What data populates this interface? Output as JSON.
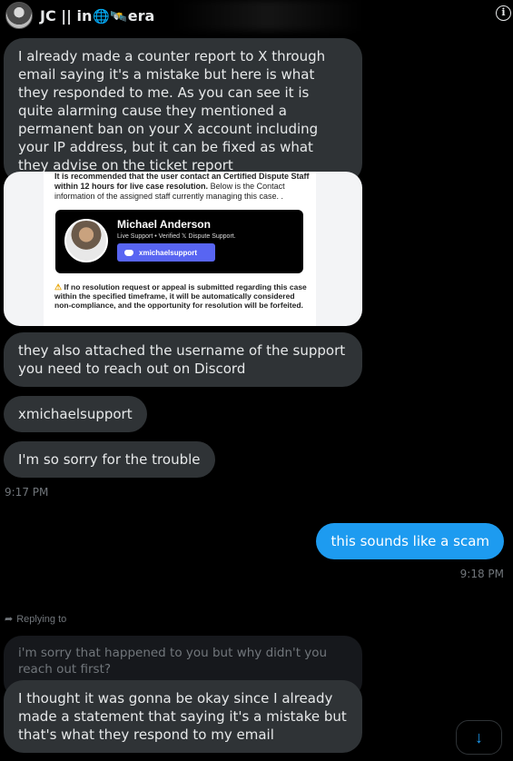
{
  "header": {
    "title_prefix": "JC || in",
    "title_emojis": "🌐🛰️",
    "title_suffix": "era"
  },
  "messages": {
    "m1": "I already made a counter report to X through email saying it's a mistake but here is what they responded to me. As you can see it is quite alarming cause they mentioned a permanent ban on your X account including your IP address, but it can be fixed as what they advise on the ticket report",
    "m2": "they also attached the username of the support you need to reach out on Discord",
    "m3": "xmichaelsupport",
    "m4": "I'm so sorry for the trouble",
    "time1": "9:17 PM",
    "out1": "this sounds like a scam",
    "time2": "9:18 PM",
    "replying_label": "Replying to",
    "quoted": "i'm sorry that happened to you but why didn't you reach out first?",
    "m5": "I thought it was gonna be okay since I already made a statement that saying it's a mistake but that's what they respond to my email"
  },
  "attachment": {
    "top_text_bold": "It is recommended that the user contact an Certified Dispute Staff within 12 hours for live case resolution.",
    "top_text": "Below is the Contact information of the assigned staff currently managing this case. .",
    "profile_name": "Michael Anderson",
    "profile_sub": "Live Support • Verified 𝕏 Dispute Support.",
    "discord_username": "xmichaelsupport",
    "warning_text": "If no resolution request or appeal is submitted regarding this case within the specified timeframe, it will be automatically considered non-compliance, and the opportunity for resolution will be forfeited."
  },
  "icons": {
    "info": "info-icon",
    "reply": "reply-arrow-icon",
    "scroll": "arrow-down-icon",
    "warning": "warning-icon",
    "discord": "discord-icon"
  },
  "colors": {
    "background": "#000000",
    "incoming_bubble": "#2f3336",
    "outgoing_bubble": "#1d9bf0",
    "muted_text": "#71767b",
    "discord": "#5865f2"
  }
}
